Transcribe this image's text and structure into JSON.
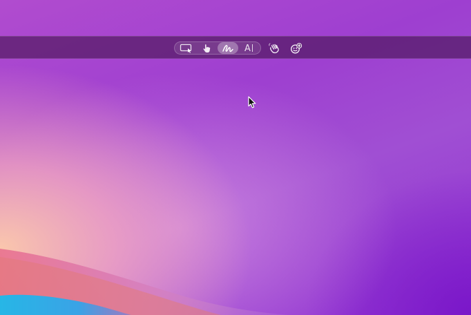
{
  "desktop": {
    "wallpaper": "macOS gradient",
    "colors": {
      "base": "#9e3fd0",
      "warm": "#ffcdaa",
      "blue": "#27b6e6",
      "bar": "#461450"
    }
  },
  "toolbar": {
    "tools": [
      {
        "id": "screen-select",
        "icon": "screen-pointer-icon"
      },
      {
        "id": "tap",
        "icon": "hand-pointer-icon"
      },
      {
        "id": "draw",
        "icon": "scribble-icon",
        "active": true
      },
      {
        "id": "text",
        "icon": "text-icon",
        "label": "A"
      }
    ],
    "extra": [
      {
        "id": "wave",
        "icon": "waving-hand-icon"
      },
      {
        "id": "sticker",
        "icon": "sticker-add-icon"
      }
    ]
  },
  "pointer": {
    "icon": "mouse-pointer-icon"
  }
}
